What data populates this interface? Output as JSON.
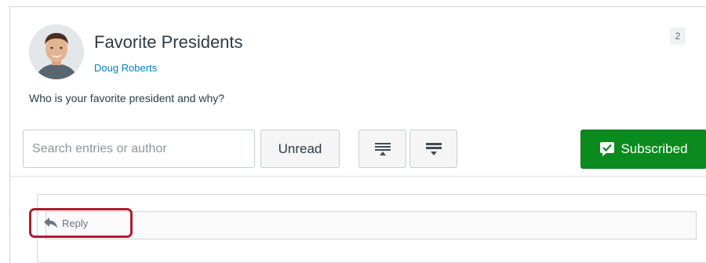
{
  "discussion": {
    "title": "Favorite Presidents",
    "author": "Doug Roberts",
    "message": "Who is your favorite president and why?",
    "count_badge": "2"
  },
  "toolbar": {
    "search_placeholder": "Search entries or author",
    "search_value": "",
    "unread_label": "Unread",
    "expand_icon": "expand-all-icon",
    "collapse_icon": "collapse-all-icon",
    "subscribed_label": "Subscribed",
    "subscribed_icon": "checkmark-icon"
  },
  "reply": {
    "label": "Reply",
    "icon": "reply-arrow-icon"
  },
  "colors": {
    "link": "#0081bd",
    "subscribed_bg": "#0b8a1e",
    "highlight_border": "#b01c2e"
  }
}
